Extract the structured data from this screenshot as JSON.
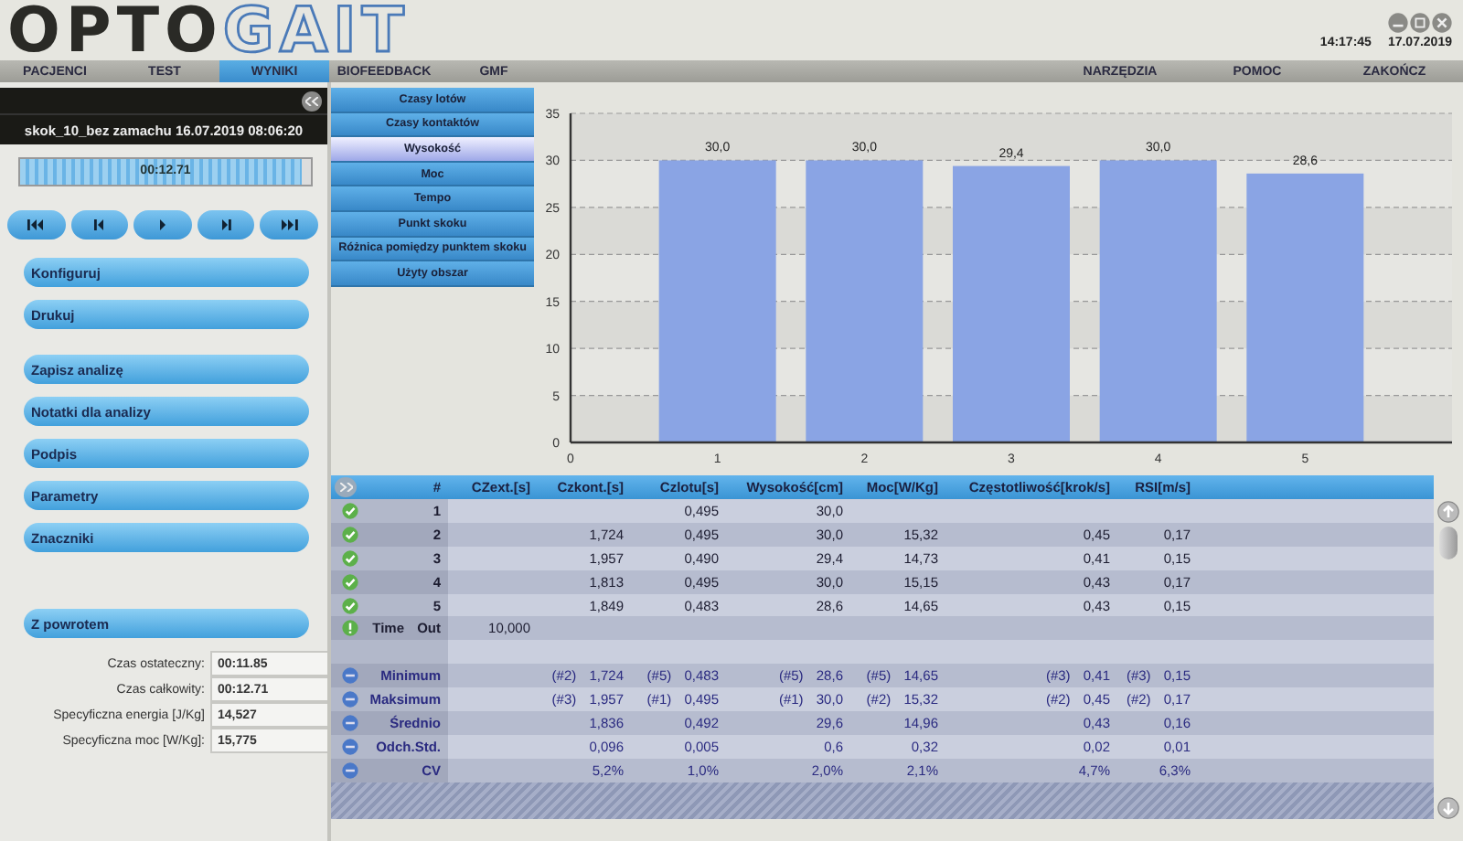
{
  "header": {
    "logo": [
      "OPTO",
      "GAIT"
    ],
    "time": "14:17:45",
    "date": "17.07.2019"
  },
  "menu": {
    "left": [
      {
        "label": "PACJENCI",
        "selected": false
      },
      {
        "label": "TEST",
        "selected": false
      },
      {
        "label": "WYNIKI",
        "selected": true
      },
      {
        "label": "BIOFEEDBACK",
        "selected": false
      },
      {
        "label": "GMF",
        "selected": false
      }
    ],
    "right": [
      "NARZĘDZIA",
      "POMOC",
      "ZAKOŃCZ"
    ]
  },
  "session": {
    "title": "skok_10_bez zamachu 16.07.2019 08:06:20",
    "time": "00:12.71",
    "level": 0.97
  },
  "transport": [
    {
      "kind": "first"
    },
    {
      "kind": "prev"
    },
    {
      "kind": "play"
    },
    {
      "kind": "next"
    },
    {
      "kind": "last"
    }
  ],
  "action_groups": [
    [
      "Konfiguruj",
      "Drukuj"
    ],
    [
      "Zapisz analizę",
      "Notatki dla analizy",
      "Podpis",
      "Parametry",
      "Znaczniki"
    ],
    [
      "Z powrotem"
    ]
  ],
  "summary": [
    {
      "label": "Czas ostateczny:",
      "value": "00:11.85"
    },
    {
      "label": "Czas całkowity:",
      "value": "00:12.71"
    },
    {
      "label": "Specyficzna energia [J/Kg]",
      "value": "14,527"
    },
    {
      "label": "Specyficzna moc [W/Kg]:",
      "value": "15,775"
    }
  ],
  "views": [
    {
      "label": "Czasy lotów",
      "selected": false
    },
    {
      "label": "Czasy kontaktów",
      "selected": false
    },
    {
      "label": "Wysokość",
      "selected": true
    },
    {
      "label": "Moc",
      "selected": false
    },
    {
      "label": "Tempo",
      "selected": false
    },
    {
      "label": "Punkt skoku",
      "selected": false
    },
    {
      "label": "Różnica pomiędzy punktem skoku",
      "selected": false
    },
    {
      "label": "Użyty obszar",
      "selected": false
    }
  ],
  "chart_data": {
    "type": "bar",
    "x": [
      1,
      2,
      3,
      4,
      5
    ],
    "xlim": [
      0,
      6
    ],
    "ylim": [
      0,
      35
    ],
    "xticks": [
      0,
      1,
      2,
      3,
      4,
      5
    ],
    "yticks": [
      0,
      5,
      10,
      15,
      20,
      25,
      30,
      35
    ],
    "grid": true,
    "value_labels": [
      "30,0",
      "30,0",
      "29,4",
      "30,0",
      "28,6"
    ],
    "series": [
      {
        "color": "#8aa4e4",
        "values": [
          30.0,
          30.0,
          29.4,
          30.0,
          28.6
        ]
      }
    ]
  },
  "table": {
    "columns": [
      "#",
      "CZext.[s]",
      "Czkont.[s]",
      "Czlotu[s]",
      "Wysokość[cm]",
      "Moc[W/Kg]",
      "Częstotliwość[krok/s]",
      "RSI[m/s]"
    ],
    "rows": [
      {
        "kind": "jump",
        "cells": [
          "1",
          null,
          null,
          "0,495",
          "30,0",
          null,
          null,
          null
        ]
      },
      {
        "kind": "jump",
        "cells": [
          "2",
          null,
          "1,724",
          "0,495",
          "30,0",
          "15,32",
          "0,45",
          "0,17"
        ]
      },
      {
        "kind": "jump",
        "cells": [
          "3",
          null,
          "1,957",
          "0,490",
          "29,4",
          "14,73",
          "0,41",
          "0,15"
        ]
      },
      {
        "kind": "jump",
        "cells": [
          "4",
          null,
          "1,813",
          "0,495",
          "30,0",
          "15,15",
          "0,43",
          "0,17"
        ]
      },
      {
        "kind": "jump",
        "cells": [
          "5",
          null,
          "1,849",
          "0,483",
          "28,6",
          "14,65",
          "0,43",
          "0,15"
        ]
      },
      {
        "kind": "timeout",
        "cells": [
          "Time Out",
          "10,000",
          null,
          null,
          null,
          null,
          null,
          null
        ]
      },
      {
        "kind": "blank",
        "cells": [
          null,
          null,
          null,
          null,
          null,
          null,
          null,
          null
        ]
      },
      {
        "kind": "stat",
        "cells": [
          "Minimum",
          null,
          "(#2) 1,724",
          "(#5) 0,483",
          "(#5) 28,6",
          "(#5) 14,65",
          "(#3) 0,41",
          "(#3) 0,15"
        ]
      },
      {
        "kind": "stat",
        "cells": [
          "Maksimum",
          null,
          "(#3) 1,957",
          "(#1) 0,495",
          "(#1) 30,0",
          "(#2) 15,32",
          "(#2) 0,45",
          "(#2) 0,17"
        ]
      },
      {
        "kind": "stat",
        "cells": [
          "Średnio",
          null,
          "1,836",
          "0,492",
          "29,6",
          "14,96",
          "0,43",
          "0,16"
        ]
      },
      {
        "kind": "stat",
        "cells": [
          "Odch.Std.",
          null,
          "0,096",
          "0,005",
          "0,6",
          "0,32",
          "0,02",
          "0,01"
        ]
      },
      {
        "kind": "stat",
        "cells": [
          "CV",
          null,
          "5,2%",
          "1,0%",
          "2,0%",
          "2,1%",
          "4,7%",
          "6,3%"
        ]
      }
    ]
  }
}
